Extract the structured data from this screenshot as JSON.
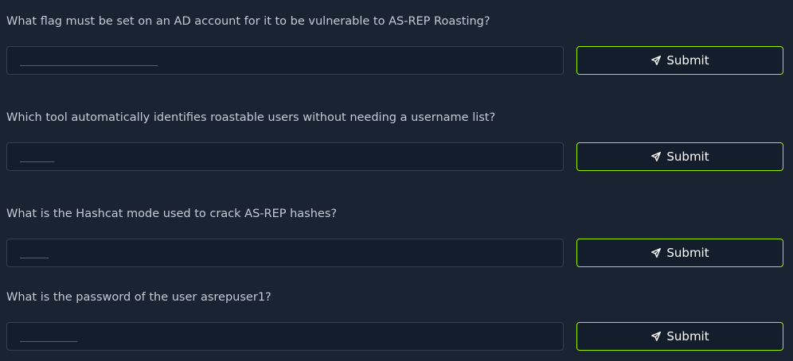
{
  "questions": [
    {
      "text": "What flag must be set on an AD account for it to be vulnerable to AS-REP Roasting?",
      "placeholder": "________________________",
      "submit_label": "Submit"
    },
    {
      "text": "Which tool automatically identifies roastable users without needing a username list?",
      "placeholder": "______",
      "submit_label": "Submit"
    },
    {
      "text": "What is the Hashcat mode used to crack AS-REP hashes?",
      "placeholder": "_____",
      "submit_label": "Submit"
    },
    {
      "text": "What is the password of the user asrepuser1?",
      "placeholder": "__________",
      "submit_label": "Submit"
    }
  ],
  "icons": {
    "submit": "send-icon"
  },
  "colors": {
    "background": "#1a2332",
    "input_background": "#141d2b",
    "button_border": "#9fef00",
    "question_text": "#c5cad3"
  }
}
